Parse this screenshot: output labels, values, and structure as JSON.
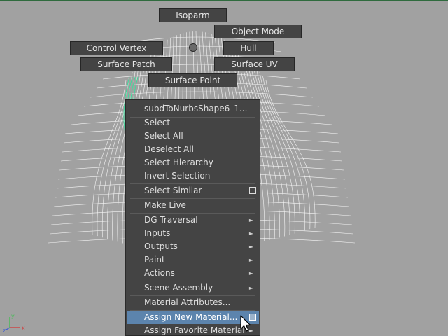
{
  "marking_menu": {
    "north": "Isoparm",
    "northeast": "Object Mode",
    "west": "Control Vertex",
    "east": "Hull",
    "southwest": "Surface Patch",
    "southeast": "Surface UV",
    "south": "Surface Point"
  },
  "context_menu": {
    "header": "subdToNurbsShape6_1...",
    "items": [
      {
        "label": "Select"
      },
      {
        "label": "Select All"
      },
      {
        "label": "Deselect All"
      },
      {
        "label": "Select Hierarchy"
      },
      {
        "label": "Invert Selection"
      },
      {
        "label": "Select Similar",
        "option_box": true
      },
      {
        "label": "Make Live"
      },
      {
        "label": "DG Traversal",
        "submenu": true
      },
      {
        "label": "Inputs",
        "submenu": true
      },
      {
        "label": "Outputs",
        "submenu": true
      },
      {
        "label": "Paint",
        "submenu": true
      },
      {
        "label": "Actions",
        "submenu": true
      },
      {
        "label": "Scene Assembly",
        "submenu": true
      },
      {
        "label": "Material Attributes..."
      },
      {
        "label": "Assign New Material...",
        "option_box": true,
        "highlighted": true
      },
      {
        "label": "Assign Favorite Material",
        "submenu": true
      }
    ]
  },
  "axis": {
    "x": "x",
    "y": "y",
    "z": "z"
  },
  "colors": {
    "viewport_bg": "#a1a1a1",
    "menu_bg": "#444444",
    "highlight": "#5c84ad",
    "wire": "#ffffff",
    "wire_selected": "#3fd89a"
  }
}
